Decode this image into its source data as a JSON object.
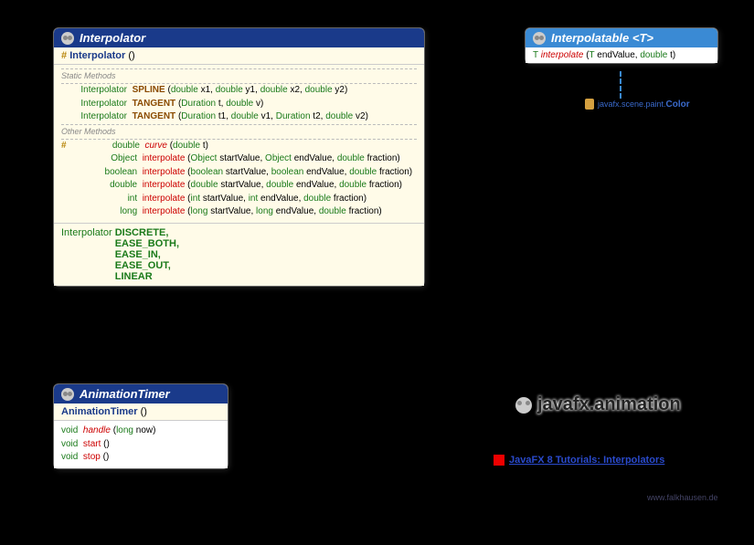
{
  "interpolator": {
    "title": "Interpolator",
    "constructor": {
      "hash": "#",
      "name": "Interpolator",
      "params": "()"
    },
    "staticHeader": "Static Methods",
    "staticMethods": [
      {
        "ret": "Interpolator",
        "name": "SPLINE",
        "params": "(double x1, double y1, double x2, double y2)"
      },
      {
        "ret": "Interpolator",
        "name": "TANGENT",
        "params": "(Duration t, double v)"
      },
      {
        "ret": "Interpolator",
        "name": "TANGENT",
        "params": "(Duration t1, double v1, Duration t2, double v2)"
      }
    ],
    "otherHeader": "Other Methods",
    "otherMethods": [
      {
        "hash": "#",
        "ret": "double",
        "name": "curve",
        "params": "(double t)",
        "italic": true
      },
      {
        "ret": "Object",
        "name": "interpolate",
        "params": "(Object startValue, Object endValue, double fraction)"
      },
      {
        "ret": "boolean",
        "name": "interpolate",
        "params": "(boolean startValue, boolean endValue, double fraction)"
      },
      {
        "ret": "double",
        "name": "interpolate",
        "params": "(double startValue, double endValue, double fraction)"
      },
      {
        "ret": "int",
        "name": "interpolate",
        "params": "(int startValue, int endValue, double fraction)"
      },
      {
        "ret": "long",
        "name": "interpolate",
        "params": "(long startValue, long endValue, double fraction)"
      }
    ],
    "fieldsLabel": "Interpolator",
    "fields": [
      "DISCRETE,",
      "EASE_BOTH,",
      "EASE_IN,",
      "EASE_OUT,",
      "LINEAR"
    ]
  },
  "interpolatable": {
    "title": "Interpolatable",
    "generic": "<T>",
    "method": {
      "ret": "T",
      "name": "interpolate",
      "params": "(T endValue, double t)",
      "italic": true
    },
    "impl": {
      "pkg": "javafx.scene.paint.",
      "cls": "Color"
    }
  },
  "animationTimer": {
    "title": "AnimationTimer",
    "constructor": {
      "name": "AnimationTimer",
      "params": "()"
    },
    "methods": [
      {
        "ret": "void",
        "name": "handle",
        "params": "(long now)",
        "italic": true
      },
      {
        "ret": "void",
        "name": "start",
        "params": "()"
      },
      {
        "ret": "void",
        "name": "stop",
        "params": "()"
      }
    ]
  },
  "package": "javafx.animation",
  "tutorial": "JavaFX 8 Tutorials: Interpolators",
  "footer": "www.falkhausen.de"
}
